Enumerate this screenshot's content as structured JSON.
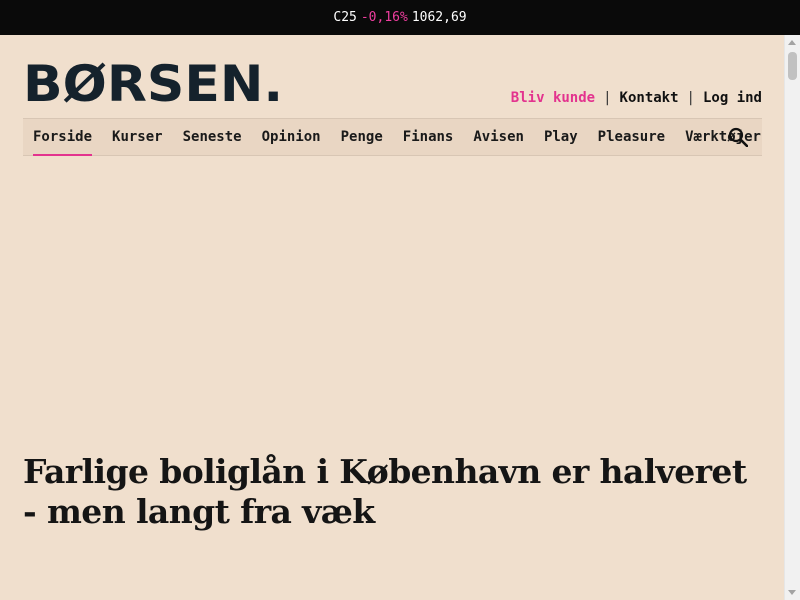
{
  "ticker": {
    "index": "C25",
    "change": "-0,16%",
    "value": "1062,69"
  },
  "brand": {
    "logo_text": "BØRSEN."
  },
  "top_links": {
    "subscribe": "Bliv kunde",
    "separator": "|",
    "contact": "Kontakt",
    "login": "Log ind"
  },
  "nav": {
    "items": [
      {
        "label": "Forside"
      },
      {
        "label": "Kurser"
      },
      {
        "label": "Seneste"
      },
      {
        "label": "Opinion"
      },
      {
        "label": "Penge"
      },
      {
        "label": "Finans"
      },
      {
        "label": "Avisen"
      },
      {
        "label": "Play"
      },
      {
        "label": "Pleasure"
      },
      {
        "label": "Værktøjer"
      }
    ],
    "active": "Forside",
    "search_icon": "search-icon"
  },
  "article": {
    "headline": "Farlige boliglån i København er halveret - men langt fra væk"
  },
  "colors": {
    "background": "#f0dfcd",
    "accent": "#e3338e",
    "ticker_bg": "#0a0a0a",
    "text": "#15222c"
  }
}
